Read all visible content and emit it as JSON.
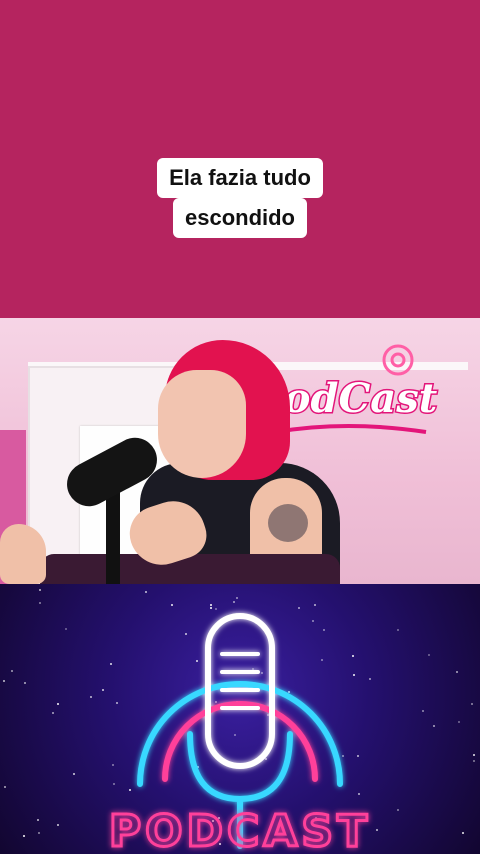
{
  "caption": {
    "line1": "Ela fazia tudo",
    "line2": "escondido"
  },
  "video_frame": {
    "watermark": "",
    "neon_sign_text": "PodCast"
  },
  "bottom_graphic": {
    "neon_text": "PODCAST",
    "colors": {
      "cyan": "#38d8ff",
      "pink": "#ff3f9a",
      "white": "#ffffff"
    }
  },
  "colors": {
    "top_band": "#b5245f",
    "caption_bg": "#ffffff",
    "caption_text": "#111111"
  }
}
